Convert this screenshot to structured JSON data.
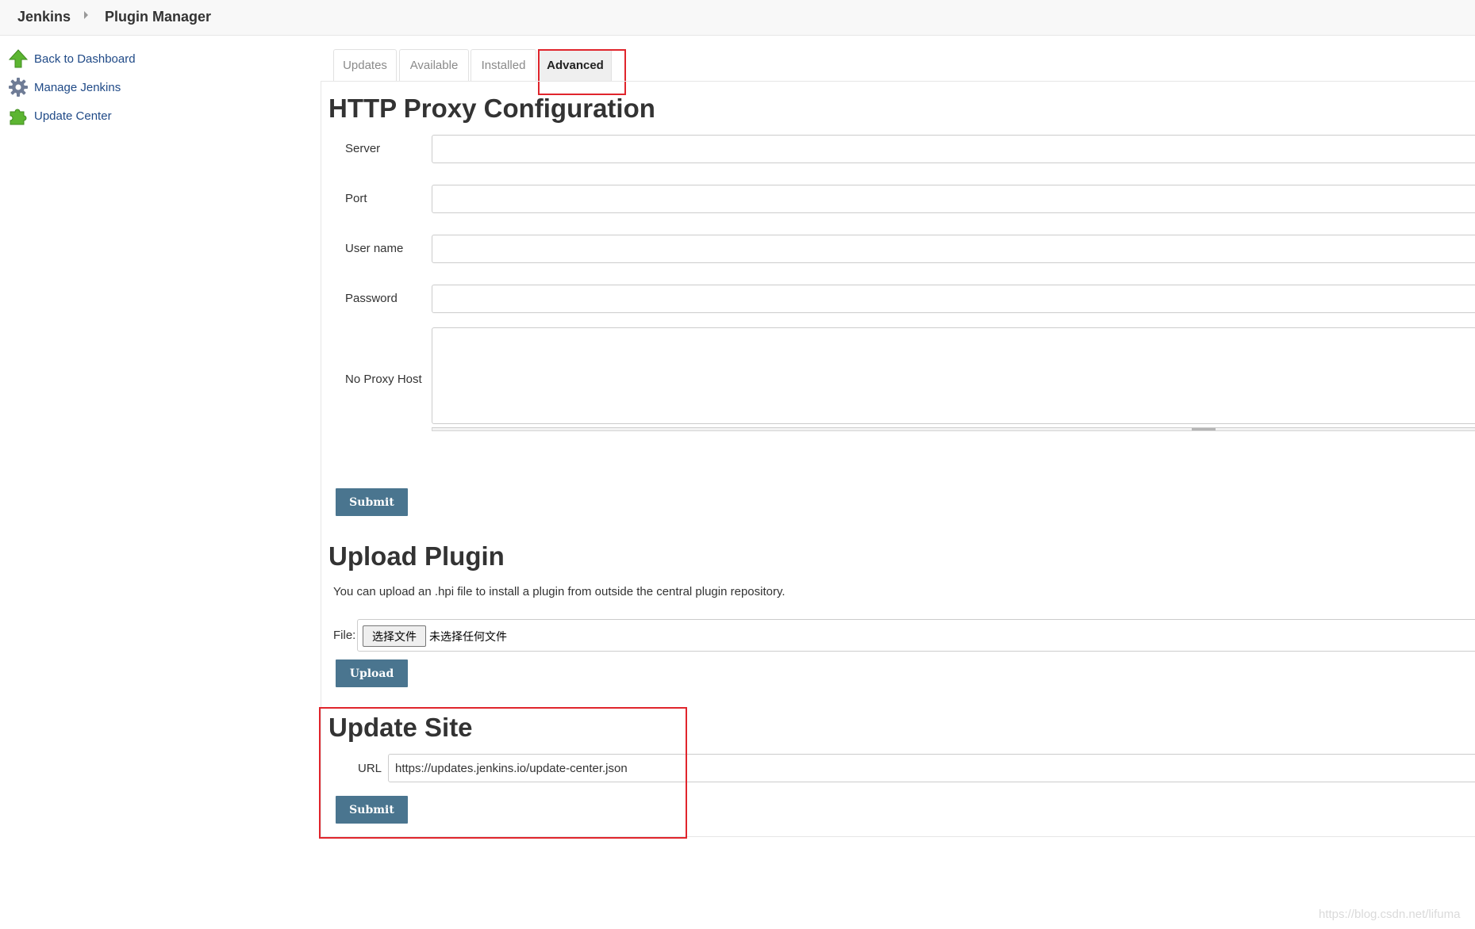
{
  "breadcrumb": {
    "root": "Jenkins",
    "current": "Plugin Manager"
  },
  "sidebar": {
    "items": [
      {
        "label": "Back to Dashboard",
        "icon": "up-arrow-icon"
      },
      {
        "label": "Manage Jenkins",
        "icon": "gear-icon"
      },
      {
        "label": "Update Center",
        "icon": "puzzle-icon"
      }
    ]
  },
  "tabs": [
    {
      "label": "Updates",
      "active": false
    },
    {
      "label": "Available",
      "active": false
    },
    {
      "label": "Installed",
      "active": false
    },
    {
      "label": "Advanced",
      "active": true
    }
  ],
  "proxy": {
    "title": "HTTP Proxy Configuration",
    "fields": {
      "server": {
        "label": "Server",
        "value": ""
      },
      "port": {
        "label": "Port",
        "value": ""
      },
      "username": {
        "label": "User name",
        "value": ""
      },
      "password": {
        "label": "Password",
        "value": ""
      },
      "no_proxy_host": {
        "label": "No Proxy Host",
        "value": ""
      }
    },
    "submit_label": "Submit"
  },
  "upload": {
    "title": "Upload Plugin",
    "description": "You can upload an .hpi file to install a plugin from outside the central plugin repository.",
    "file_label": "File:",
    "choose_label": "选择文件",
    "file_status": "未选择任何文件",
    "button_label": "Upload"
  },
  "update_site": {
    "title": "Update Site",
    "url_label": "URL",
    "url_value": "https://updates.jenkins.io/update-center.json",
    "submit_label": "Submit"
  },
  "watermark": "https://blog.csdn.net/lifuma",
  "colors": {
    "button": "#4a758f",
    "highlight": "#e0252c",
    "link": "#204a87",
    "icon_green": "#5cb531",
    "icon_gear": "#6f7c96"
  }
}
